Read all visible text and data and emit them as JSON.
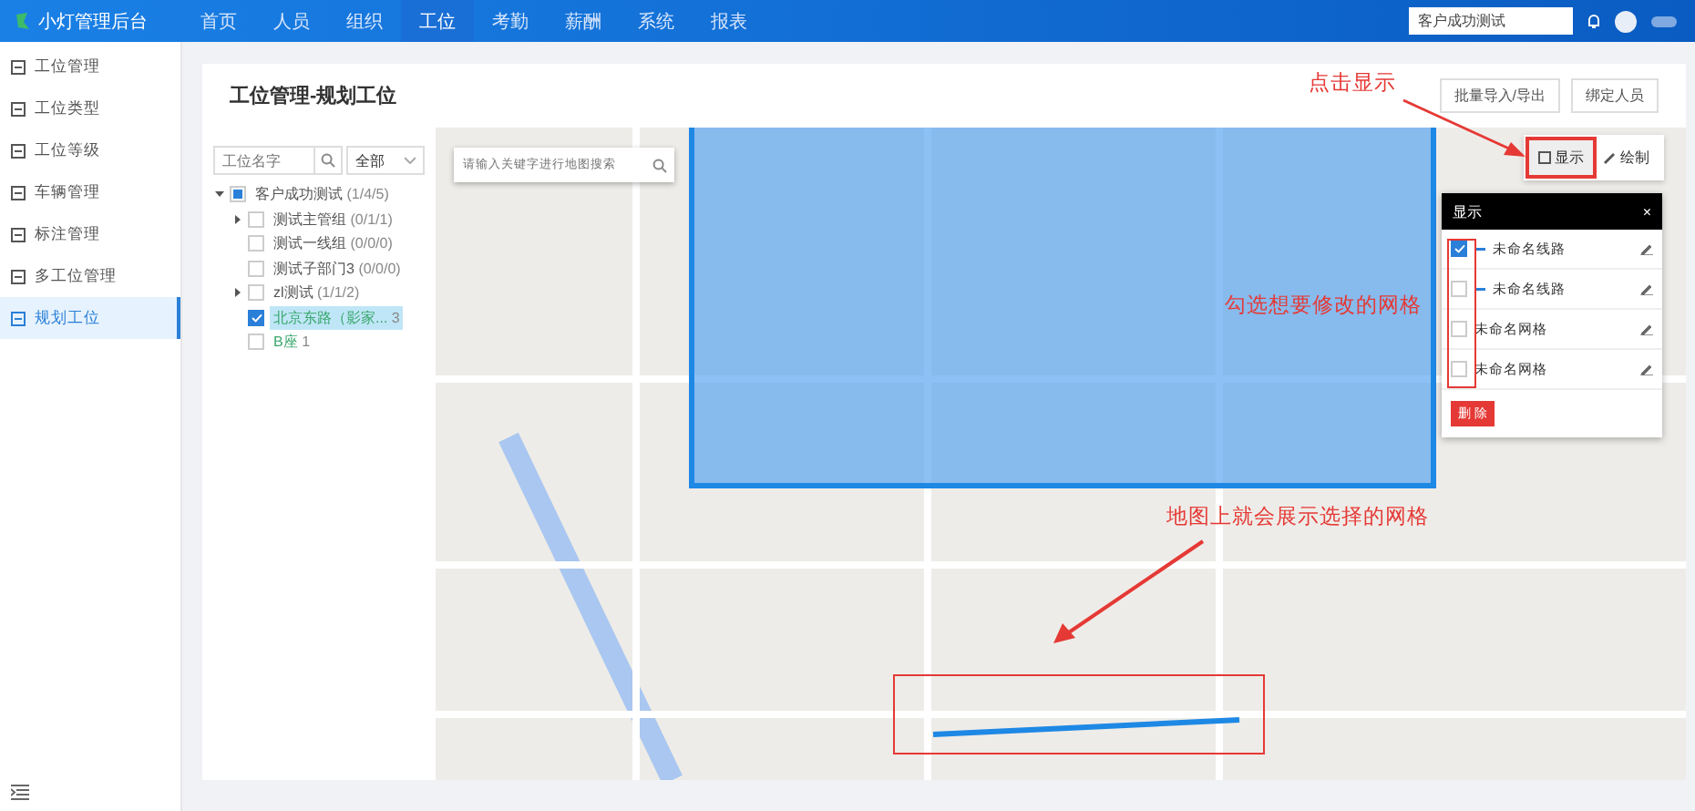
{
  "header": {
    "app_name": "小灯管理后台",
    "nav": [
      {
        "label": "首页",
        "selected": false
      },
      {
        "label": "人员",
        "selected": false
      },
      {
        "label": "组织",
        "selected": false
      },
      {
        "label": "工位",
        "selected": true
      },
      {
        "label": "考勤",
        "selected": false
      },
      {
        "label": "薪酬",
        "selected": false
      },
      {
        "label": "系统",
        "selected": false
      },
      {
        "label": "报表",
        "selected": false
      }
    ],
    "company_field": "客户成功测试"
  },
  "sidebar": {
    "items": [
      {
        "label": "工位管理",
        "selected": false
      },
      {
        "label": "工位类型",
        "selected": false
      },
      {
        "label": "工位等级",
        "selected": false
      },
      {
        "label": "车辆管理",
        "selected": false
      },
      {
        "label": "标注管理",
        "selected": false
      },
      {
        "label": "多工位管理",
        "selected": false
      },
      {
        "label": "规划工位",
        "selected": true
      }
    ]
  },
  "page": {
    "title": "工位管理-规划工位",
    "buttons": [
      "批量导入/导出",
      "绑定人员"
    ]
  },
  "tree": {
    "search_placeholder": "工位名字",
    "filter": "全部",
    "root": {
      "label": "客户成功测试",
      "count": "(1/4/5)",
      "expanded": true,
      "checked": false,
      "indeterminate": true,
      "children": [
        {
          "kind": "group",
          "label": "测试主管组",
          "count": "(0/1/1)",
          "has_children": true,
          "checked": false,
          "selected": false
        },
        {
          "kind": "group",
          "label": "测试一线组",
          "count": "(0/0/0)",
          "has_children": false,
          "checked": false,
          "selected": false
        },
        {
          "kind": "group",
          "label": "测试子部门3",
          "count": "(0/0/0)",
          "has_children": false,
          "checked": false,
          "selected": false
        },
        {
          "kind": "group",
          "label": "zl测试",
          "count": "(1/1/2)",
          "has_children": true,
          "checked": false,
          "selected": false
        },
        {
          "kind": "station",
          "label": "北京东路（影家...",
          "count": "3",
          "has_children": false,
          "checked": true,
          "selected": true
        },
        {
          "kind": "station",
          "label": "B座",
          "count": "1",
          "has_children": false,
          "checked": false,
          "selected": false
        }
      ]
    }
  },
  "map": {
    "search_placeholder": "请输入关键字进行地图搜索",
    "tools": [
      {
        "label": "显示",
        "kind": "display"
      },
      {
        "label": "绘制",
        "kind": "draw"
      }
    ],
    "display_panel": {
      "title": "显示",
      "close": "×",
      "items": [
        {
          "kind": "line",
          "label": "未命名线路",
          "checked": true
        },
        {
          "kind": "line",
          "label": "未命名线路",
          "checked": false
        },
        {
          "kind": "grid",
          "label": "未命名网格",
          "checked": false
        },
        {
          "kind": "grid",
          "label": "未命名网格",
          "checked": false
        }
      ],
      "delete_button": "删 除"
    }
  },
  "annotations": [
    "点击显示",
    "勾选想要修改的网格",
    "地图上就会展示选择的网格"
  ]
}
